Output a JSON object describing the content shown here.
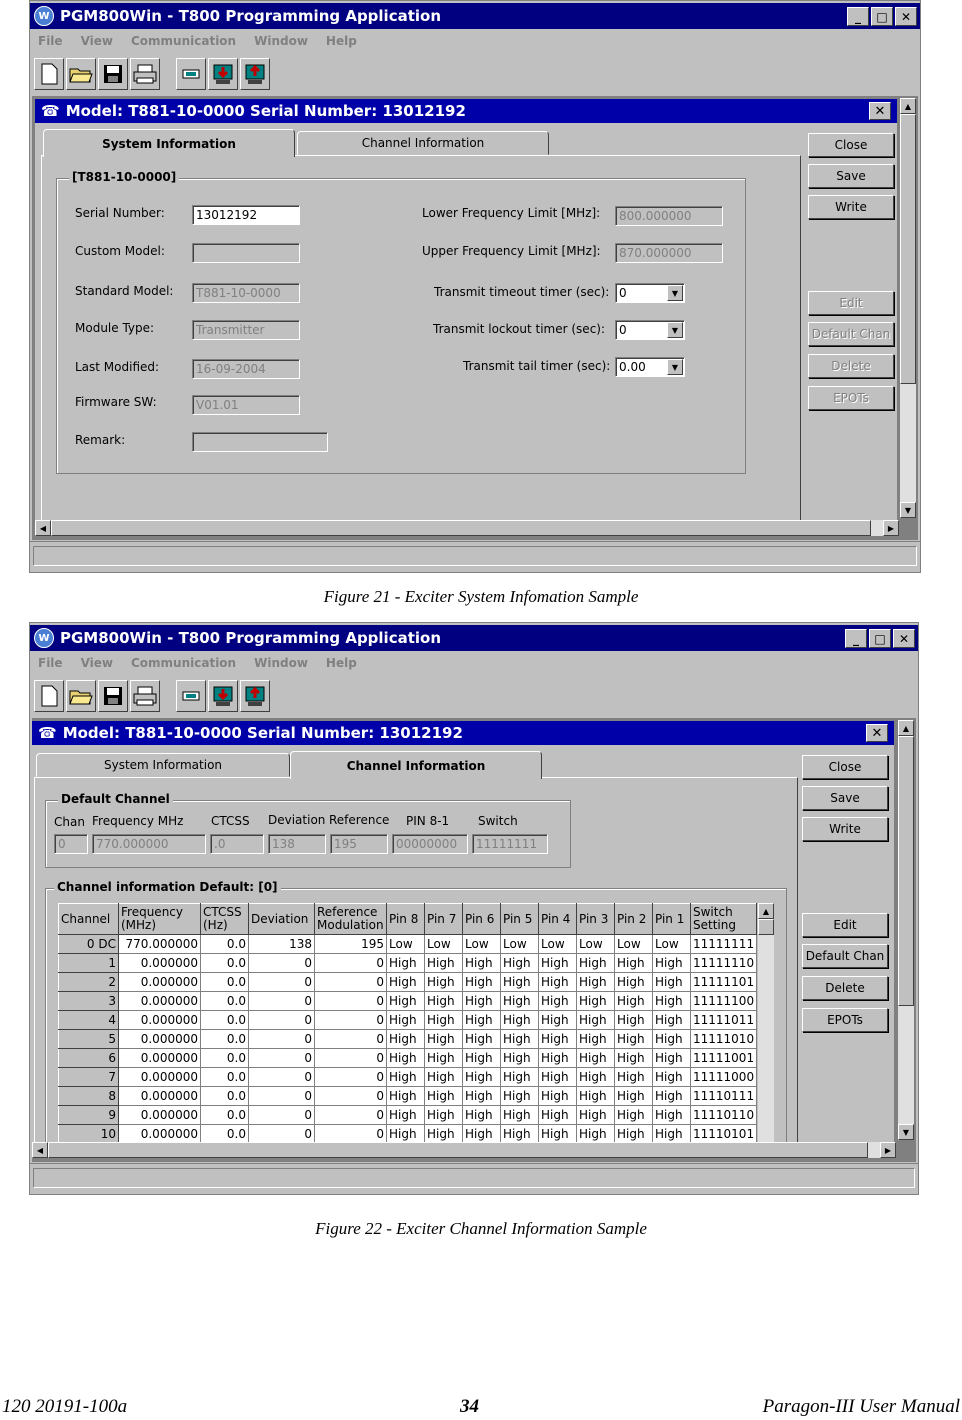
{
  "app": {
    "title": "PGM800Win  -  T800 Programming  Application",
    "window_buttons": [
      "_",
      "□",
      "✕"
    ],
    "menu": [
      "File",
      "View",
      "Communication",
      "Window",
      "Help"
    ]
  },
  "screenshot1": {
    "child_title": "Model:  T881-10-0000  Serial  Number:  13012192",
    "tabs": [
      "System Information",
      "Channel Information"
    ],
    "group_title": "[T881-10-0000]",
    "left_fields": [
      {
        "label": "Serial Number:",
        "value": "13012192"
      },
      {
        "label": "Custom Model:",
        "value": ""
      },
      {
        "label": "Standard Model:",
        "value": "T881-10-0000"
      },
      {
        "label": "Module Type:",
        "value": "Transmitter"
      },
      {
        "label": "Last Modified:",
        "value": "16-09-2004"
      },
      {
        "label": "Firmware SW:",
        "value": "V01.01"
      },
      {
        "label": "Remark:",
        "value": ""
      }
    ],
    "right_fields": [
      {
        "label": "Lower Frequency  Limit [MHz]:",
        "value": "800.000000"
      },
      {
        "label": "Upper Frequency  Limit [MHz]:",
        "value": "870.000000"
      },
      {
        "label": "Transmit timeout timer (sec):",
        "value": "0"
      },
      {
        "label": "Transmit lockout timer (sec):",
        "value": "0"
      },
      {
        "label": "Transmit tail timer (sec):",
        "value": "0.00"
      }
    ],
    "buttons": [
      "Close",
      "Save",
      "Write",
      "Edit",
      "Default Chan",
      "Delete",
      "EPOTs"
    ],
    "caption": "Figure 21 - Exciter System Infomation Sample"
  },
  "screenshot2": {
    "child_title": "Model:  T881-10-0000  Serial  Number:  13012192",
    "tabs": [
      "System Information",
      "Channel Information"
    ],
    "default_channel": {
      "title": "Default Channel",
      "labels": [
        "Chan",
        "Frequency MHz",
        "CTCSS",
        "Deviation",
        "Reference",
        "PIN 8-1",
        "Switch"
      ],
      "values": [
        "0",
        "770.000000",
        ".0",
        "138",
        "195",
        "00000000",
        "11111111"
      ]
    },
    "channel_info_title": "Channel information   Default:  [0]",
    "columns": [
      "Channel",
      "Frequency (MHz)",
      "CTCSS (Hz)",
      "Deviation",
      "Reference Modulation",
      "Pin 8",
      "Pin 7",
      "Pin 6",
      "Pin 5",
      "Pin 4",
      "Pin 3",
      "Pin 2",
      "Pin 1",
      "Switch Setting"
    ],
    "rows": [
      [
        "0 DC",
        "770.000000",
        "0.0",
        "138",
        "195",
        "Low",
        "Low",
        "Low",
        "Low",
        "Low",
        "Low",
        "Low",
        "Low",
        "11111111"
      ],
      [
        "1",
        "0.000000",
        "0.0",
        "0",
        "0",
        "High",
        "High",
        "High",
        "High",
        "High",
        "High",
        "High",
        "High",
        "11111110"
      ],
      [
        "2",
        "0.000000",
        "0.0",
        "0",
        "0",
        "High",
        "High",
        "High",
        "High",
        "High",
        "High",
        "High",
        "High",
        "11111101"
      ],
      [
        "3",
        "0.000000",
        "0.0",
        "0",
        "0",
        "High",
        "High",
        "High",
        "High",
        "High",
        "High",
        "High",
        "High",
        "11111100"
      ],
      [
        "4",
        "0.000000",
        "0.0",
        "0",
        "0",
        "High",
        "High",
        "High",
        "High",
        "High",
        "High",
        "High",
        "High",
        "11111011"
      ],
      [
        "5",
        "0.000000",
        "0.0",
        "0",
        "0",
        "High",
        "High",
        "High",
        "High",
        "High",
        "High",
        "High",
        "High",
        "11111010"
      ],
      [
        "6",
        "0.000000",
        "0.0",
        "0",
        "0",
        "High",
        "High",
        "High",
        "High",
        "High",
        "High",
        "High",
        "High",
        "11111001"
      ],
      [
        "7",
        "0.000000",
        "0.0",
        "0",
        "0",
        "High",
        "High",
        "High",
        "High",
        "High",
        "High",
        "High",
        "High",
        "11111000"
      ],
      [
        "8",
        "0.000000",
        "0.0",
        "0",
        "0",
        "High",
        "High",
        "High",
        "High",
        "High",
        "High",
        "High",
        "High",
        "11110111"
      ],
      [
        "9",
        "0.000000",
        "0.0",
        "0",
        "0",
        "High",
        "High",
        "High",
        "High",
        "High",
        "High",
        "High",
        "High",
        "11110110"
      ],
      [
        "10",
        "0.000000",
        "0.0",
        "0",
        "0",
        "High",
        "High",
        "High",
        "High",
        "High",
        "High",
        "High",
        "High",
        "11110101"
      ]
    ],
    "buttons": [
      "Close",
      "Save",
      "Write",
      "Edit",
      "Default Chan",
      "Delete",
      "EPOTs"
    ],
    "caption": "Figure 22 - Exciter Channel Information Sample"
  },
  "footer": {
    "doc_number": "120 20191-100a",
    "page": "34",
    "manual": "Paragon-III User Manual"
  },
  "colors": {
    "titlebar": "#000080",
    "child_titlebar": "#0000a8",
    "face": "#c0c0c0"
  },
  "icons": [
    "new-file-icon",
    "open-folder-icon",
    "save-disk-icon",
    "print-icon",
    "module-icon",
    "download-icon",
    "upload-icon"
  ]
}
